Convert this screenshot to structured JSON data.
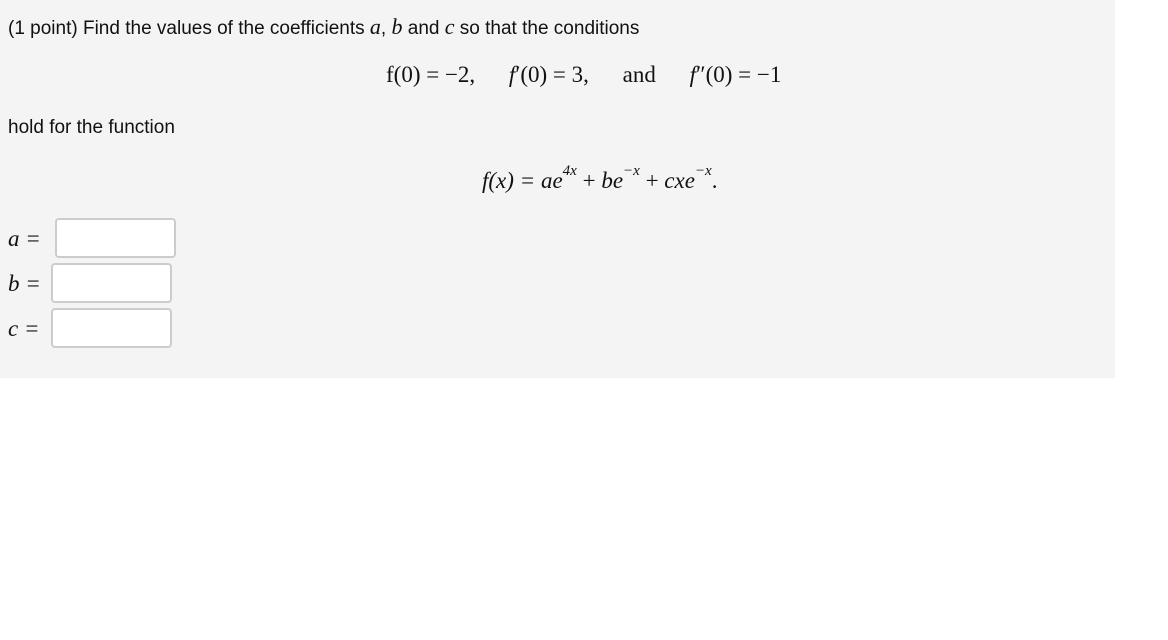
{
  "problem": {
    "intro_prefix": "(1 point) Find the values of the coefficients",
    "var_a": "a",
    "comma": ",",
    "var_b": "b",
    "and_word": "and",
    "var_c": "c",
    "intro_suffix": "so that the conditions",
    "conditions": {
      "cond1": "f(0) = −2,",
      "cond2_f": "f",
      "cond2_rest": "′(0) = 3,",
      "and_word": "and",
      "cond3_f": "f",
      "cond3_rest": "″(0) = −1"
    },
    "hold_text": "hold for the function",
    "function": {
      "lhs": "f(x) = ",
      "term1_coef": "ae",
      "term1_exp": "4x",
      "plus1": " + ",
      "term2_coef": "be",
      "term2_exp": "−x",
      "plus2": " + ",
      "term3_coef": "cxe",
      "term3_exp": "−x",
      "period": "."
    }
  },
  "answers": [
    {
      "label": "a =",
      "value": "",
      "placeholder": ""
    },
    {
      "label": "b =",
      "value": "",
      "placeholder": ""
    },
    {
      "label": "c =",
      "value": "",
      "placeholder": ""
    }
  ]
}
